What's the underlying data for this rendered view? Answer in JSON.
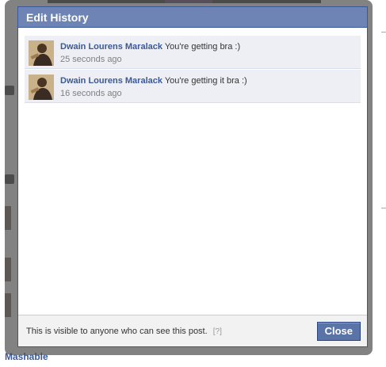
{
  "dialog": {
    "title": "Edit History",
    "footer_note": "This is visible to anyone who can see this post.",
    "help_link": "[?]",
    "close_label": "Close"
  },
  "history": [
    {
      "author": "Dwain Lourens Maralack",
      "comment": "You're getting bra :)",
      "timestamp": "25 seconds ago"
    },
    {
      "author": "Dwain Lourens Maralack",
      "comment": "You're getting it bra :)",
      "timestamp": "16 seconds ago"
    }
  ],
  "background": {
    "bottom_link": "Mashable"
  },
  "colors": {
    "header_blue": "#6d84b4",
    "link_blue": "#3b5998",
    "item_bg": "#edeff4",
    "button_blue": "#5b74a8"
  }
}
